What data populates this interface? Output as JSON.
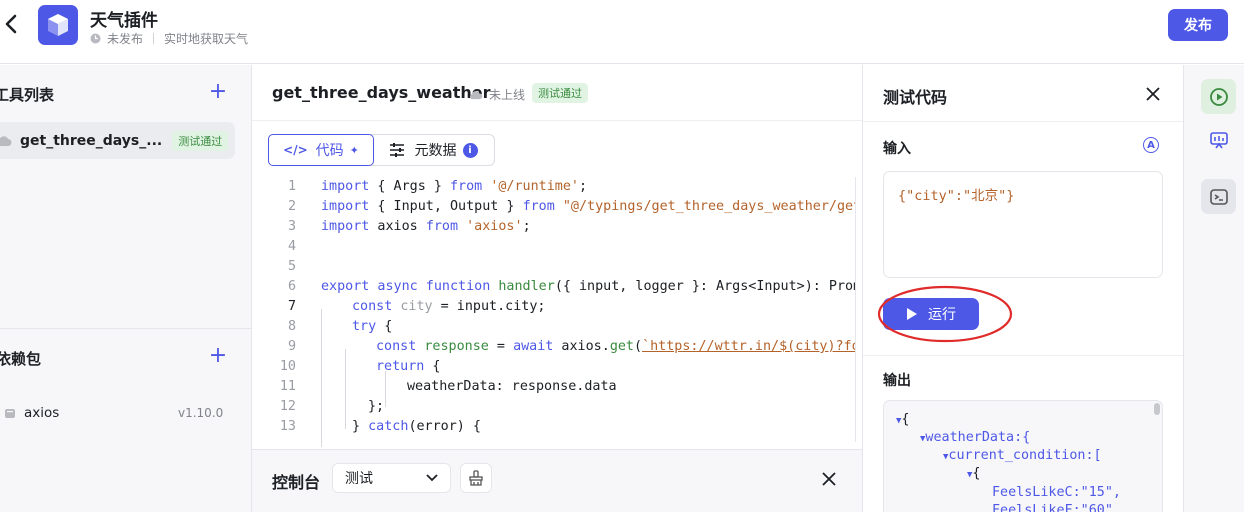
{
  "header": {
    "title": "天气插件",
    "status": "未发布",
    "description": "实时地获取天气",
    "publish_label": "发布"
  },
  "left_panel": {
    "tools_title": "工具列表",
    "tools": [
      {
        "name": "get_three_days_...",
        "badge": "测试通过"
      }
    ],
    "deps_title": "依赖包",
    "deps": [
      {
        "name": "axios",
        "version": "v1.10.0"
      }
    ]
  },
  "function_header": {
    "name": "get_three_days_weather",
    "online_status": "未上线",
    "test_badge": "测试通过"
  },
  "editor_tabs": [
    {
      "label": "代码"
    },
    {
      "label": "元数据"
    }
  ],
  "code_lines": [
    {
      "num": "1",
      "text": "import { Args } from '@/runtime';"
    },
    {
      "num": "2",
      "text": "import { Input, Output } from \"@/typings/get_three_days_weather/get_t"
    },
    {
      "num": "3",
      "text": "import axios from 'axios';"
    },
    {
      "num": "4",
      "text": ""
    },
    {
      "num": "5",
      "text": ""
    },
    {
      "num": "6",
      "text": "export async function handler({ input, logger }: Args<Input>): Promis"
    },
    {
      "num": "7",
      "text": "const city = input.city;"
    },
    {
      "num": "8",
      "text": "try {"
    },
    {
      "num": "9",
      "text": "const response = await axios.get(`https://wttr.in/$(city)?form"
    },
    {
      "num": "10",
      "text": "return {"
    },
    {
      "num": "11",
      "text": "weatherData: response.data"
    },
    {
      "num": "12",
      "text": "};"
    },
    {
      "num": "13",
      "text": "} catch(error) {"
    }
  ],
  "console": {
    "title": "控制台",
    "selected": "测试"
  },
  "test_panel": {
    "title": "测试代码",
    "input_label": "输入",
    "input_value": "{\"city\":\"北京\"}",
    "run_label": "运行",
    "output_label": "输出",
    "output_lines": [
      "{",
      "weatherData:{",
      "current_condition:[",
      "{",
      "FeelsLikeC:\"15\",",
      "FeelsLikeF:\"60\","
    ]
  },
  "icons": {
    "back": "chevron-left-icon",
    "logo": "cube-icon",
    "run": "play-icon",
    "close": "close-icon"
  },
  "colors": {
    "accent": "#4e58e6",
    "success": "#3a8a3f",
    "annotation": "#e02b2b"
  }
}
